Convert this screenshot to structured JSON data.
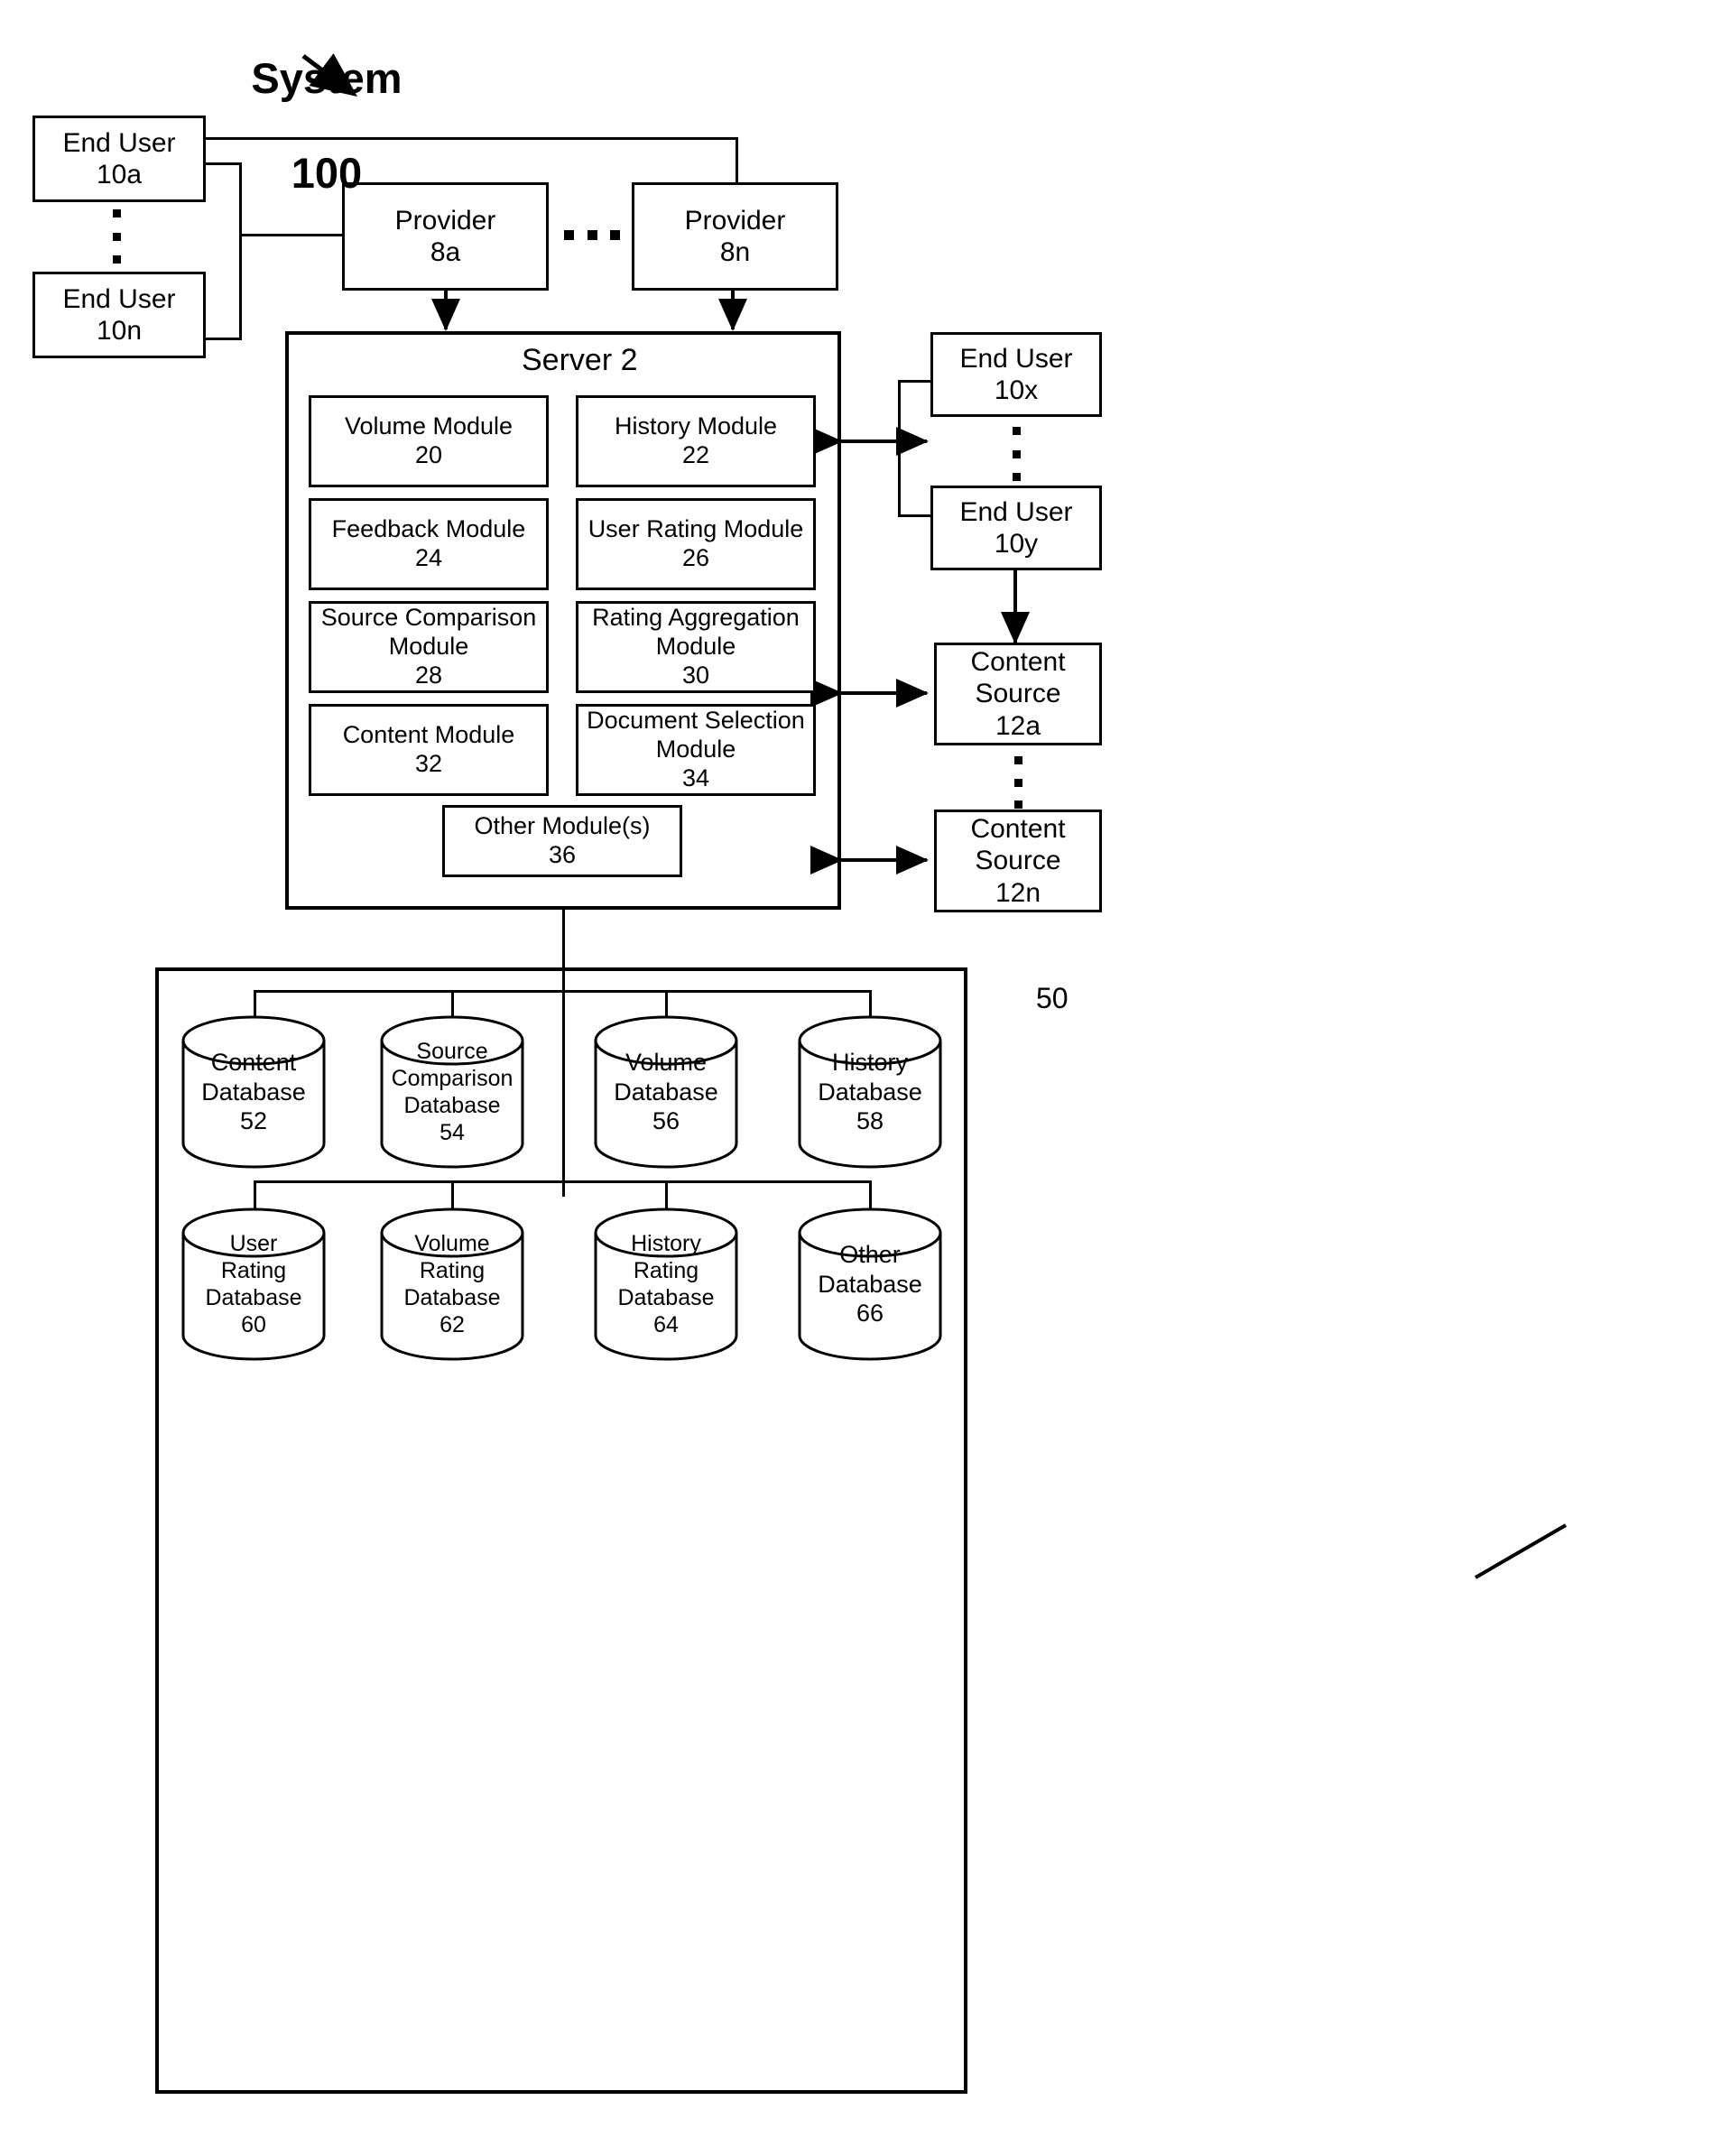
{
  "figure": {
    "title_line1": "System",
    "title_line2": "100",
    "db_group_ref": "50"
  },
  "end_users_left": [
    {
      "line1": "End User",
      "line2": "10a"
    },
    {
      "line1": "End User",
      "line2": "10n"
    }
  ],
  "providers": [
    {
      "line1": "Provider",
      "line2": "8a"
    },
    {
      "line1": "Provider",
      "line2": "8n"
    }
  ],
  "server": {
    "title": "Server 2",
    "modules": [
      {
        "line1": "Volume Module",
        "line2": "20"
      },
      {
        "line1": "History Module",
        "line2": "22"
      },
      {
        "line1": "Feedback Module",
        "line2": "24"
      },
      {
        "line1": "User Rating Module",
        "line2": "26"
      },
      {
        "line1": "Source Comparison",
        "line2": "Module",
        "line3": "28"
      },
      {
        "line1": "Rating Aggregation",
        "line2": "Module",
        "line3": "30"
      },
      {
        "line1": "Content Module",
        "line2": "32"
      },
      {
        "line1": "Document Selection",
        "line2": "Module",
        "line3": "34"
      }
    ],
    "other_module": {
      "line1": "Other Module(s)",
      "line2": "36"
    }
  },
  "end_users_right": [
    {
      "line1": "End User",
      "line2": "10x"
    },
    {
      "line1": "End User",
      "line2": "10y"
    }
  ],
  "content_sources": [
    {
      "line1": "Content",
      "line2": "Source",
      "line3": "12a"
    },
    {
      "line1": "Content",
      "line2": "Source",
      "line3": "12n"
    }
  ],
  "databases_row1": [
    {
      "line1": "Content",
      "line2": "Database",
      "line3": "52"
    },
    {
      "line1": "Source",
      "line2": "Comparison",
      "line3": "Database",
      "line4": "54"
    },
    {
      "line1": "Volume",
      "line2": "Database",
      "line3": "56"
    },
    {
      "line1": "History",
      "line2": "Database",
      "line3": "58"
    }
  ],
  "databases_row2": [
    {
      "line1": "User",
      "line2": "Rating",
      "line3": "Database",
      "line4": "60"
    },
    {
      "line1": "Volume",
      "line2": "Rating",
      "line3": "Database",
      "line4": "62"
    },
    {
      "line1": "History",
      "line2": "Rating",
      "line3": "Database",
      "line4": "64"
    },
    {
      "line1": "Other",
      "line2": "Database",
      "line3": "66"
    }
  ]
}
